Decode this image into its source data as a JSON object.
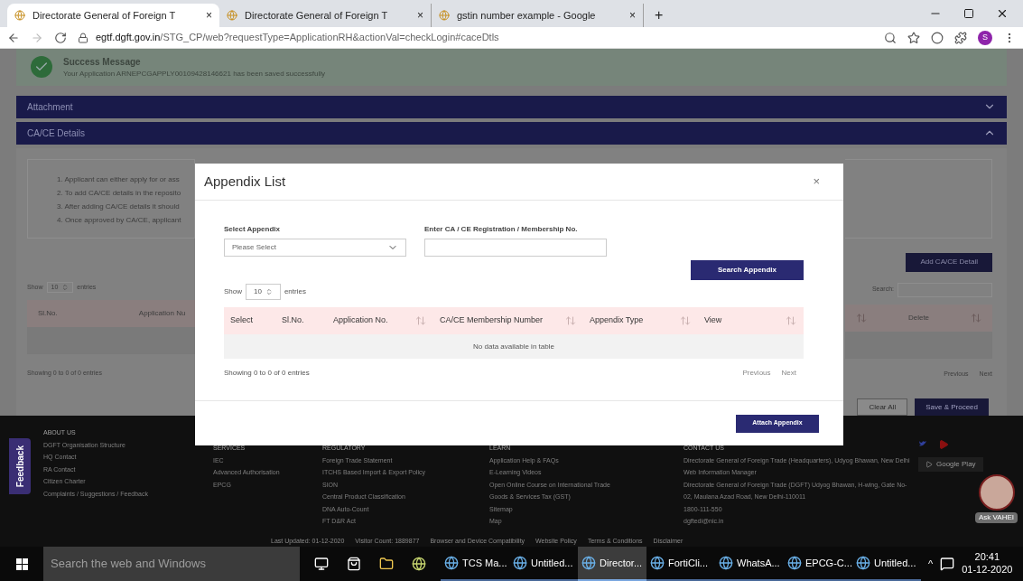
{
  "browser": {
    "tabs": [
      {
        "label": "Directorate General of Foreign T",
        "close": "×",
        "selected": true
      },
      {
        "label": "Directorate General of Foreign T",
        "close": "×",
        "selected": false
      },
      {
        "label": "gstin number example - Google",
        "close": "×",
        "selected": false
      }
    ],
    "new_tab": "+",
    "url_domain": "egtf.dgft.gov.in",
    "url_path": "/STG_CP/web?requestType=ApplicationRH&actionVal=checkLogin#caceDtls",
    "profile": "S"
  },
  "success": {
    "title": "Success Message",
    "text": "Your Application ARNEPCGAPPLY00109428146621 has been saved successfully"
  },
  "accordions": [
    {
      "title": "Attachment",
      "expanded": false
    },
    {
      "title": "CA/CE Details",
      "expanded": true
    }
  ],
  "background": {
    "instructions": [
      "1. Applicant can either apply for or ass",
      "2. To add CA/CE details in the reposito",
      "3. After adding CA/CE details it should",
      "4. Once approved by CA/CE, applicant"
    ],
    "show": "Show",
    "entries_value": "10",
    "entries": "entries",
    "columns_left": [
      "Sl.No.",
      "Application Nu"
    ],
    "columns_right": [
      "Delete"
    ],
    "showing": "Showing 0 to 0 of 0 entries",
    "add_button": "Add CA/CE Detail",
    "search_label": "Search:",
    "previous": "Previous",
    "next": "Next",
    "clear_button": "Clear All",
    "save_button": "Save & Proceed"
  },
  "modal": {
    "title": "Appendix List",
    "close": "×",
    "select_label": "Select Appendix",
    "select_value": "Please Select",
    "input_label": "Enter CA / CE Registration / Membership No.",
    "search_button": "Search Appendix",
    "show": "Show",
    "entries_value": "10",
    "entries": "entries",
    "columns": [
      "Select",
      "Sl.No.",
      "Application No.",
      "CA/CE Membership Number",
      "Appendix Type",
      "View"
    ],
    "empty": "No data available in table",
    "showing": "Showing 0 to 0 of 0 entries",
    "previous": "Previous",
    "next": "Next",
    "attach_button": "Attach Appendix"
  },
  "footer": {
    "feedback": "Feedback",
    "columns": [
      {
        "heading": "ABOUT US",
        "links": [
          "DGFT Organisation Structure",
          "HQ Contact",
          "RA Contact",
          "Citizen Charter",
          "Complaints / Suggestions / Feedback"
        ]
      },
      {
        "heading": "SERVICES",
        "links": [
          "IEC",
          "Advanced Authorisation",
          "EPCG"
        ]
      },
      {
        "heading": "REGULATORY",
        "links": [
          "Foreign Trade Statement",
          "ITCHS Based Import & Export Policy",
          "SION",
          "Central Product Classification",
          "DNA Auto-Count",
          "FT D&R Act"
        ]
      },
      {
        "heading": "LEARN",
        "links": [
          "Application Help & FAQs",
          "E-Learning Videos",
          "Open Online Course on International Trade",
          "Goods & Services Tax (GST)",
          "Sitemap",
          "Map"
        ]
      },
      {
        "heading": "CONTACT US",
        "links": [
          "Directorate General of Foreign Trade (Headquarters), Udyog Bhawan, New Delhi",
          "Web Information Manager",
          "Directorate General of Foreign Trade (DGFT) Udyog Bhawan, H-wing, Gate No-",
          "02, Maulana Azad Road, New Delhi-110011",
          "1800-111-550",
          "dgftedi@nic.in"
        ]
      }
    ],
    "store": "Google Play",
    "bottom_links": [
      "Last Updated: 01-12-2020",
      "Visitor Count: 1889877",
      "Browser and Device Compatibility",
      "Website Policy",
      "Terms & Conditions",
      "Disclaimer"
    ],
    "chatbot": "Ask VAHEI"
  },
  "taskbar": {
    "search_placeholder": "Search the web and Windows",
    "apps": [
      {
        "label": "TCS Ma...",
        "selected": false
      },
      {
        "label": "Untitled...",
        "selected": false
      },
      {
        "label": "Director...",
        "selected": true
      },
      {
        "label": "FortiCli...",
        "selected": false
      },
      {
        "label": "WhatsA...",
        "selected": false
      },
      {
        "label": "EPCG-C...",
        "selected": false
      },
      {
        "label": "Untitled...",
        "selected": false
      }
    ],
    "caret": "^",
    "time": "20:41",
    "date": "01-12-2020"
  }
}
